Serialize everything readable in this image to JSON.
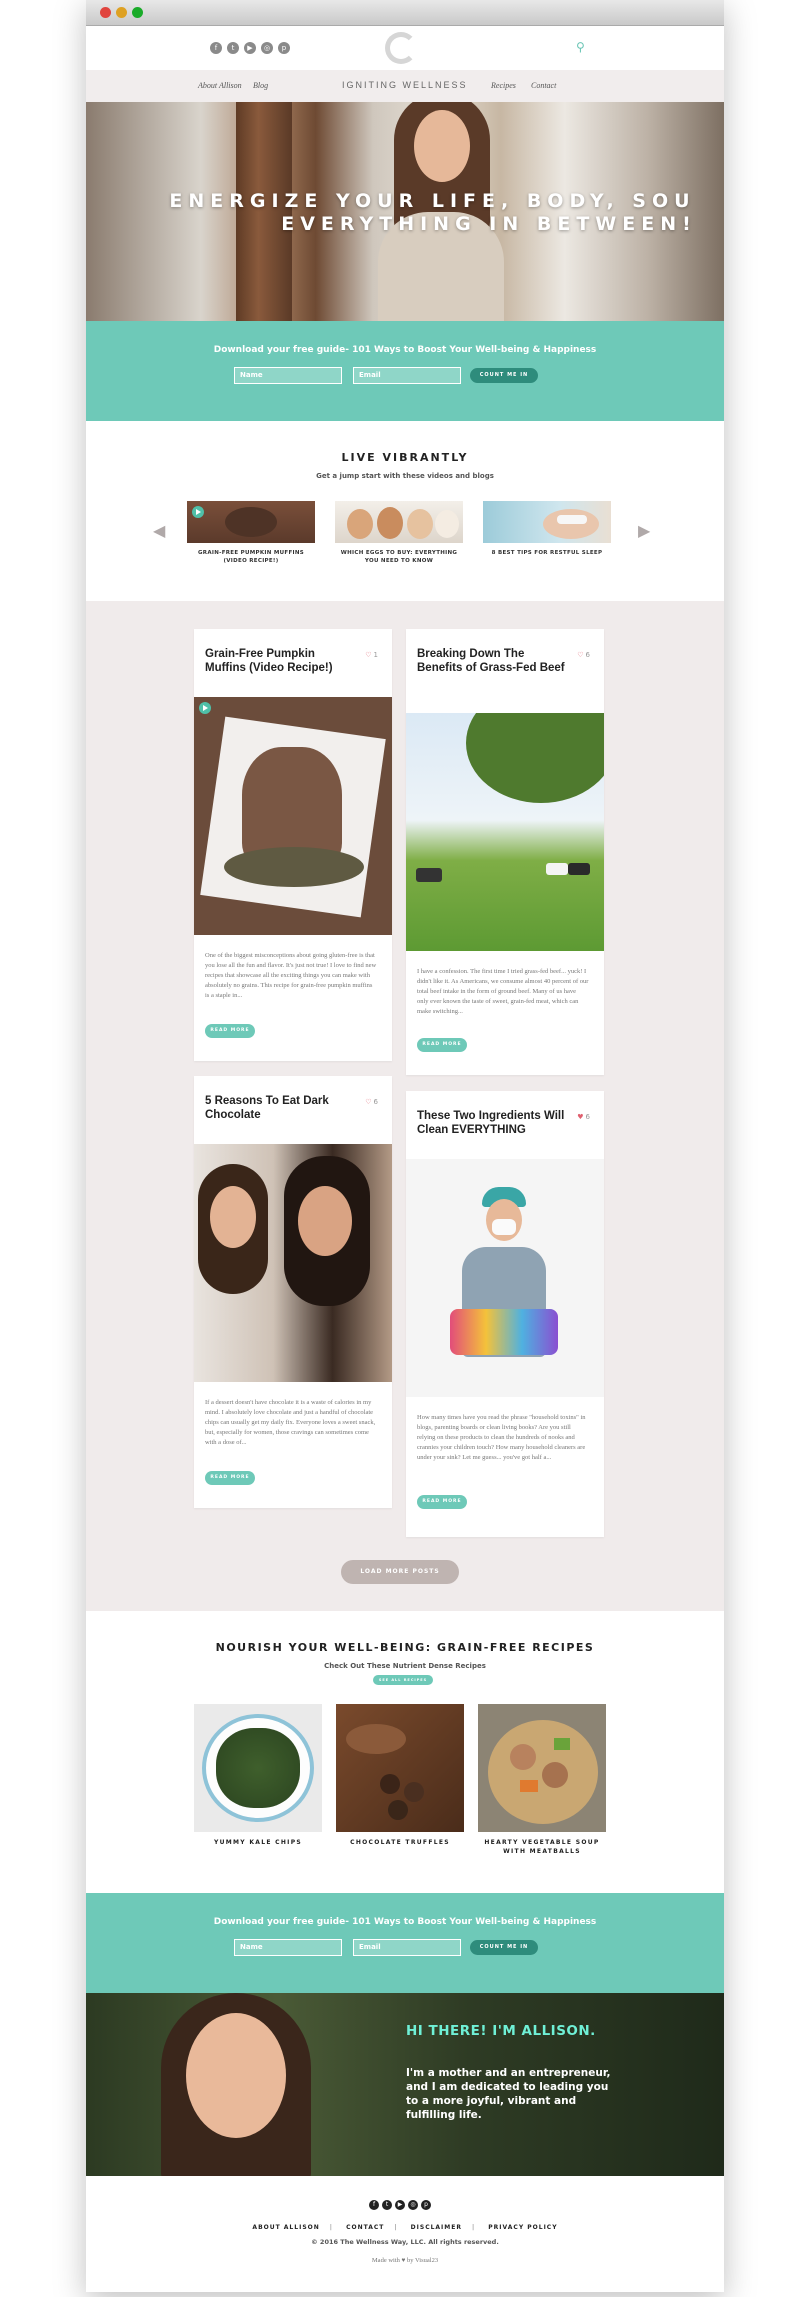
{
  "social_icons": [
    "facebook-icon",
    "twitter-icon",
    "youtube-icon",
    "instagram-icon",
    "pinterest-icon"
  ],
  "nav": {
    "about": "About Allison",
    "blog": "Blog",
    "brand": "IGNITING WELLNESS",
    "recipes": "Recipes",
    "contact": "Contact"
  },
  "hero": {
    "line1": "ENERGIZE YOUR LIFE, BODY, SOU",
    "line2": "EVERYTHING IN BETWEEN!"
  },
  "optin": {
    "title": "Download your free guide- 101 Ways to Boost Your Well-being & Happiness",
    "name_placeholder": "Name",
    "email_placeholder": "Email",
    "button": "COUNT ME IN"
  },
  "live": {
    "title": "LIVE VIBRANTLY",
    "subtitle": "Get a jump start with these videos and blogs",
    "items": [
      {
        "caption": "GRAIN-FREE PUMPKIN MUFFINS (VIDEO RECIPE!)"
      },
      {
        "caption": "WHICH EGGS TO BUY: EVERYTHING YOU NEED TO KNOW"
      },
      {
        "caption": "8 BEST TIPS FOR RESTFUL SLEEP"
      }
    ]
  },
  "posts": [
    {
      "title": "Grain-Free Pumpkin Muffins (Video Recipe!)",
      "likes": "1",
      "excerpt": "One of the biggest misconceptions about going gluten-free is that you lose all the fun and flavor. It's just not true! I love to find new recipes that showcase all the exciting things you can make with absolutely no grains. This recipe for grain-free pumpkin muffins is a staple in...",
      "cta": "READ MORE"
    },
    {
      "title": "Breaking Down The Benefits of Grass-Fed Beef",
      "likes": "6",
      "excerpt": "I have a confession. The first time I tried grass-fed beef... yuck! I didn't like it. As Americans, we consume almost 40 percent of our total beef intake in the form of ground beef. Many of us have only ever known the taste of sweet, grain-fed meat, which can make switching...",
      "cta": "READ MORE"
    },
    {
      "title": "5 Reasons To Eat Dark Chocolate",
      "likes": "6",
      "excerpt": "If a dessert doesn't have chocolate it is a waste of calories in my mind. I absolutely love chocolate and just a handful of chocolate chips can usually get my daily fix. Everyone loves a sweet snack, but, especially for women, those cravings can sometimes come with a dose of...",
      "cta": "READ MORE"
    },
    {
      "title": "These Two Ingredients Will Clean EVERYTHING",
      "likes": "6",
      "excerpt": "How many times have you read the phrase \"household toxins\" in blogs, parenting boards or clean living books? Are you still relying on these products to clean the hundreds of nooks and crannies your children touch? How many household cleaners are under your sink? Let me guess... you've got half a...",
      "cta": "READ MORE"
    }
  ],
  "load_more": "LOAD MORE POSTS",
  "recipes": {
    "title": "NOURISH YOUR WELL-BEING: GRAIN-FREE RECIPES",
    "subtitle": "Check Out These Nutrient Dense Recipes",
    "pill": "SEE ALL RECIPES",
    "items": [
      {
        "caption": "YUMMY KALE CHIPS"
      },
      {
        "caption": "CHOCOLATE TRUFFLES"
      },
      {
        "caption": "HEARTY VEGETABLE SOUP WITH MEATBALLS"
      }
    ]
  },
  "optin2": {
    "title": "Download your free guide- 101 Ways to Boost Your Well-being & Happiness",
    "name_placeholder": "Name",
    "email_placeholder": "Email",
    "button": "COUNT ME IN"
  },
  "about": {
    "greeting": "HI THERE! I'M ALLISON.",
    "bio": "I'm a mother and an entrepreneur, and I am dedicated to leading you to a more joyful, vibrant and fulfilling life."
  },
  "footer": {
    "links": [
      "ABOUT ALLISON",
      "CONTACT",
      "DISCLAIMER",
      "PRIVACY POLICY"
    ],
    "copyright": "© 2016 The Wellness Way, LLC. All rights reserved.",
    "made_prefix": "Made with",
    "made_suffix": "by Visual23"
  }
}
